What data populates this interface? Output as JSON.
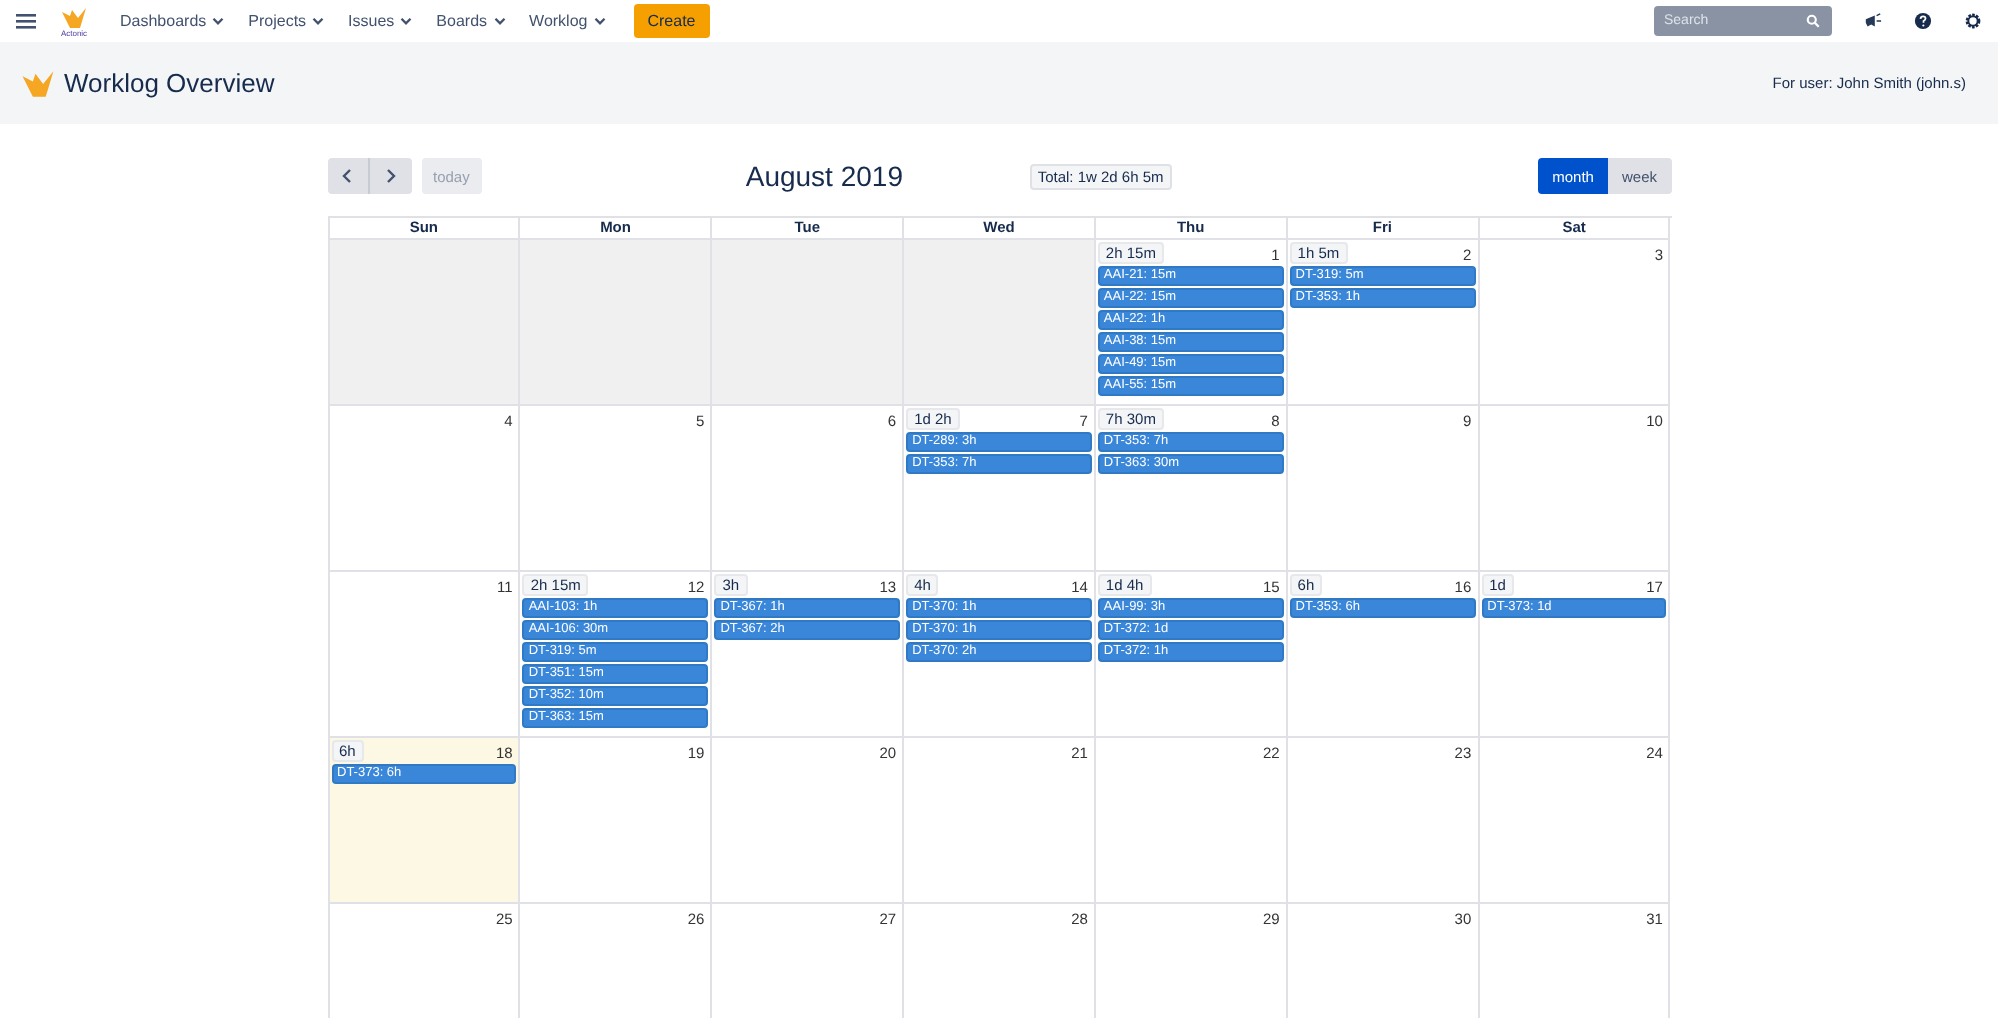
{
  "nav": {
    "logo_text": "Actonic",
    "menus": [
      "Dashboards",
      "Projects",
      "Issues",
      "Boards",
      "Worklog"
    ],
    "create": "Create",
    "search": {
      "placeholder": "Search"
    }
  },
  "header": {
    "title": "Worklog Overview",
    "user": "For user: John Smith (john.s)"
  },
  "toolbar": {
    "today": "today",
    "title": "August 2019",
    "total": "Total: 1w 2d 6h 5m",
    "views": [
      {
        "label": "month",
        "selected": true
      },
      {
        "label": "week",
        "selected": false
      }
    ]
  },
  "weekdays": [
    "Sun",
    "Mon",
    "Tue",
    "Wed",
    "Thu",
    "Fri",
    "Sat"
  ],
  "weeks": [
    [
      {
        "other_month": true
      },
      {
        "other_month": true
      },
      {
        "other_month": true
      },
      {
        "other_month": true
      },
      {
        "day": "1",
        "today": false,
        "total": "2h 15m",
        "entries": [
          "AAI-21: 15m",
          "AAI-22: 15m",
          "AAI-22: 1h",
          "AAI-38: 15m",
          "AAI-49: 15m",
          "AAI-55: 15m"
        ]
      },
      {
        "day": "2",
        "today": false,
        "total": "1h 5m",
        "entries": [
          "DT-319: 5m",
          "DT-353: 1h"
        ]
      },
      {
        "day": "3",
        "today": false
      }
    ],
    [
      {
        "day": "4",
        "today": false
      },
      {
        "day": "5",
        "today": false
      },
      {
        "day": "6",
        "today": false
      },
      {
        "day": "7",
        "today": false,
        "total": "1d 2h",
        "entries": [
          "DT-289: 3h",
          "DT-353: 7h"
        ]
      },
      {
        "day": "8",
        "today": false,
        "total": "7h 30m",
        "entries": [
          "DT-353: 7h",
          "DT-363: 30m"
        ]
      },
      {
        "day": "9",
        "today": false
      },
      {
        "day": "10",
        "today": false
      }
    ],
    [
      {
        "day": "11",
        "today": false
      },
      {
        "day": "12",
        "today": false,
        "total": "2h 15m",
        "entries": [
          "AAI-103: 1h",
          "AAI-106: 30m",
          "DT-319: 5m",
          "DT-351: 15m",
          "DT-352: 10m",
          "DT-363: 15m"
        ]
      },
      {
        "day": "13",
        "today": false,
        "total": "3h",
        "entries": [
          "DT-367: 1h",
          "DT-367: 2h"
        ]
      },
      {
        "day": "14",
        "today": false,
        "total": "4h",
        "entries": [
          "DT-370: 1h",
          "DT-370: 1h",
          "DT-370: 2h"
        ]
      },
      {
        "day": "15",
        "today": false,
        "total": "1d 4h",
        "entries": [
          "AAI-99: 3h",
          "DT-372: 1d",
          "DT-372: 1h"
        ]
      },
      {
        "day": "16",
        "today": false,
        "total": "6h",
        "entries": [
          "DT-353: 6h"
        ]
      },
      {
        "day": "17",
        "today": false,
        "total": "1d",
        "entries": [
          "DT-373: 1d"
        ]
      }
    ],
    [
      {
        "day": "18",
        "today": true,
        "total": "6h",
        "entries": [
          "DT-373: 6h"
        ]
      },
      {
        "day": "19",
        "today": false
      },
      {
        "day": "20",
        "today": false
      },
      {
        "day": "21",
        "today": false
      },
      {
        "day": "22",
        "today": false
      },
      {
        "day": "23",
        "today": false
      },
      {
        "day": "24",
        "today": false
      }
    ],
    [
      {
        "day": "25",
        "today": false
      },
      {
        "day": "26",
        "today": false
      },
      {
        "day": "27",
        "today": false
      },
      {
        "day": "28",
        "today": false
      },
      {
        "day": "29",
        "today": false
      },
      {
        "day": "30",
        "today": false
      },
      {
        "day": "31",
        "today": false
      }
    ]
  ]
}
